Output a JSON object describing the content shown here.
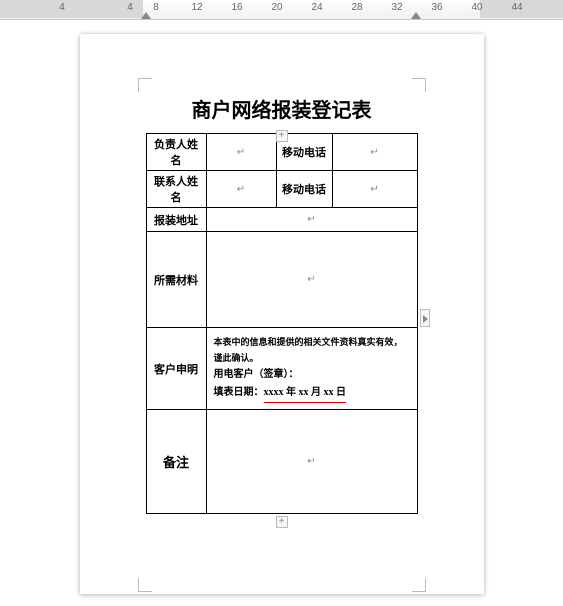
{
  "ruler": {
    "numbers": [
      "4",
      "4",
      "8",
      "12",
      "16",
      "20",
      "24",
      "28",
      "32",
      "36",
      "40",
      "44"
    ]
  },
  "doc": {
    "title": "商户网络报装登记表",
    "rows": {
      "responsible_name_label": "负责人姓名",
      "responsible_name_value": "",
      "mobile1_label": "移动电话",
      "mobile1_value": "",
      "contact_name_label": "联系人姓名",
      "contact_name_value": "",
      "mobile2_label": "移动电话",
      "mobile2_value": "",
      "install_addr_label": "报装地址",
      "install_addr_value": "",
      "materials_label": "所需材料",
      "materials_value": "",
      "declaration_label": "客户申明",
      "declaration_line1": "本表中的信息和提供的相关文件资料真实有效，谨此确认。",
      "declaration_line2": "用电客户（签章）：",
      "declaration_line3_prefix": "填表日期：",
      "declaration_line3_date": "xxxx 年 xx 月 xx 日",
      "remark_label": "备注",
      "remark_value": ""
    },
    "placeholder_mark": "↵"
  },
  "controls": {
    "add": "+"
  }
}
